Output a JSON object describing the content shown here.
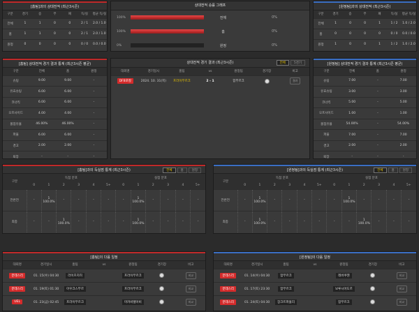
{
  "h2h_home": {
    "title": "[홈팀]과의 상대전적 (최근3시즌)",
    "headers": [
      "구분",
      "경기",
      "승",
      "무",
      "패",
      "득/실",
      "평균 득/실"
    ],
    "rows": [
      [
        "전체",
        "1",
        "1",
        "0",
        "0",
        "2 / 1",
        "2.0 / 1.0"
      ],
      [
        "홈",
        "1",
        "1",
        "0",
        "0",
        "2 / 1",
        "2.0 / 1.0"
      ],
      [
        "원정",
        "0",
        "0",
        "0",
        "0",
        "0 / 0",
        "0.0 / 0.0"
      ]
    ]
  },
  "h2h_graph": {
    "title": "상대전적 승률 그래프",
    "rows": [
      {
        "left_pct": "100%",
        "fill": 1.0,
        "label": "전체",
        "right_pct": "0%"
      },
      {
        "left_pct": "100%",
        "fill": 1.0,
        "label": "홈",
        "right_pct": "0%"
      },
      {
        "left_pct": "0%",
        "fill": 0.0,
        "label": "원정",
        "right_pct": "0%"
      }
    ]
  },
  "h2h_away": {
    "title": "[원정팀]과의 상대전적 (최근3시즌)",
    "headers": [
      "구분",
      "경기",
      "승",
      "무",
      "패",
      "득/실",
      "평균 득/실"
    ],
    "rows": [
      [
        "전체",
        "1",
        "0",
        "0",
        "1",
        "1 / 2",
        "1.0 / 2.0"
      ],
      [
        "홈",
        "0",
        "0",
        "0",
        "0",
        "0 / 0",
        "0.0 / 0.0"
      ],
      [
        "원정",
        "1",
        "0",
        "0",
        "1",
        "1 / 2",
        "1.0 / 2.0"
      ]
    ]
  },
  "stats_home": {
    "title": "[홈팀] 상대전적 경기 결과 통계 (최근3시즌 평균)",
    "headers": [
      "구분",
      "전체",
      "홈",
      "원정"
    ],
    "rows": [
      [
        "슈팅",
        "9.00",
        "9.00",
        "-"
      ],
      [
        "유효슈팅",
        "6.00",
        "6.00",
        "-"
      ],
      [
        "코너킥",
        "6.00",
        "6.00",
        "-"
      ],
      [
        "오프사이드",
        "4.00",
        "4.00",
        "-"
      ],
      [
        "볼점유율",
        "46.00%",
        "46.00%",
        "-"
      ],
      [
        "파울",
        "6.00",
        "6.00",
        "-"
      ],
      [
        "경고",
        "2.00",
        "2.00",
        "-"
      ],
      [
        "퇴장",
        "-",
        "-",
        "-"
      ]
    ]
  },
  "recent": {
    "title": "상대전적 경기 결과 (최근3시즌)",
    "tabs": [
      "전체",
      "5경기"
    ],
    "headers": [
      "대회명",
      "경기일시",
      "홈팀",
      "vs",
      "원정팀",
      "경기장",
      "비고"
    ],
    "rows": [
      {
        "league": "DFB포칼",
        "date": "2024. 10. 31(목)",
        "home": "프라이부르크",
        "score": "2 - 1",
        "away": "함부르크",
        "note": "결과"
      }
    ]
  },
  "stats_away": {
    "title": "[원정팀] 상대전적 경기 결과 통계 (최근3시즌 평균)",
    "headers": [
      "구분",
      "전체",
      "홈",
      "원정"
    ],
    "rows": [
      [
        "슈팅",
        "7.00",
        "-",
        "7.00"
      ],
      [
        "유효슈팅",
        "3.00",
        "-",
        "3.00"
      ],
      [
        "코너킥",
        "5.00",
        "-",
        "5.00"
      ],
      [
        "오프사이드",
        "1.00",
        "-",
        "1.00"
      ],
      [
        "볼점유율",
        "54.00%",
        "-",
        "54.00%"
      ],
      [
        "파울",
        "7.00",
        "-",
        "7.00"
      ],
      [
        "경고",
        "2.00",
        "-",
        "2.00"
      ],
      [
        "퇴장",
        "-",
        "-",
        "-"
      ]
    ]
  },
  "goals_home": {
    "title": "[홈팀]과의 득실점 통계 (최근3시즌)",
    "tabs": [
      "전체",
      "홈",
      "원정"
    ],
    "group_headers": [
      "득점 분포",
      "실점 분포"
    ],
    "cols": [
      "0",
      "1",
      "2",
      "3",
      "4",
      "5+"
    ],
    "row_label_header": "구분",
    "rows": [
      {
        "label": "전반전",
        "score": [
          "-",
          "1\n100.0%",
          "-",
          "-",
          "-",
          "-"
        ],
        "concede": [
          "-",
          "1\n100.0%",
          "-",
          "-",
          "-",
          "-"
        ]
      },
      {
        "label": "최종",
        "score": [
          "-",
          "-",
          "1\n100.0%",
          "-",
          "-",
          "-"
        ],
        "concede": [
          "-",
          "1\n100.0%",
          "-",
          "-",
          "-",
          "-"
        ]
      }
    ]
  },
  "goals_away": {
    "title": "[원정팀]과의 득실점 통계 (최근3시즌)",
    "tabs": [
      "전체",
      "홈",
      "원정"
    ],
    "group_headers": [
      "득점 분포",
      "실점 분포"
    ],
    "cols": [
      "0",
      "1",
      "2",
      "3",
      "4",
      "5+"
    ],
    "row_label_header": "구분",
    "rows": [
      {
        "label": "전반전",
        "score": [
          "-",
          "1\n100.0%",
          "-",
          "-",
          "-",
          "-"
        ],
        "concede": [
          "-",
          "1\n100.0%",
          "-",
          "-",
          "-",
          "-"
        ]
      },
      {
        "label": "최종",
        "score": [
          "-",
          "1\n100.0%",
          "-",
          "-",
          "-",
          "-"
        ],
        "concede": [
          "-",
          "-",
          "1\n100.0%",
          "-",
          "-",
          "-"
        ]
      }
    ]
  },
  "next_home": {
    "title": "[홈팀]의 다음 일정",
    "headers": [
      "대회명",
      "경기일시",
      "홈팀",
      "vs",
      "원정팀",
      "경기장",
      "비고"
    ],
    "rows": [
      {
        "league": "분데스리",
        "date": "01. 15(수) 04:30",
        "home": "라이프치히",
        "away": "프라이부르크",
        "note": "비교"
      },
      {
        "league": "분데스리",
        "date": "01. 19(토) 01:30",
        "home": "아우크스부르",
        "away": "프라이부르크",
        "note": "비교"
      },
      {
        "league": "UEL",
        "date": "01. 23(금) 02:45",
        "home": "프라이부르크",
        "away": "마카비텔아비",
        "note": "비교"
      }
    ]
  },
  "next_away": {
    "title": "[원정팀]의 다음 일정",
    "headers": [
      "대회명",
      "경기일시",
      "홈팀",
      "vs",
      "원정팀",
      "경기장",
      "비고"
    ],
    "rows": [
      {
        "league": "분데스리",
        "date": "01. 14(수) 04:30",
        "home": "함부르크",
        "away": "레버쿠젠",
        "note": "비교"
      },
      {
        "league": "분데스리",
        "date": "01. 17(토) 23:30",
        "home": "함부르크",
        "away": "보루시아도르",
        "note": "비교"
      },
      {
        "league": "분데스리",
        "date": "01. 24(토) 04:30",
        "home": "장크트파울리",
        "away": "함부르크",
        "note": "비교"
      }
    ]
  },
  "colors": {
    "accent_red": "#d42b2b",
    "accent_blue": "#3b6fc4",
    "highlight_yellow": "#e8c300"
  }
}
